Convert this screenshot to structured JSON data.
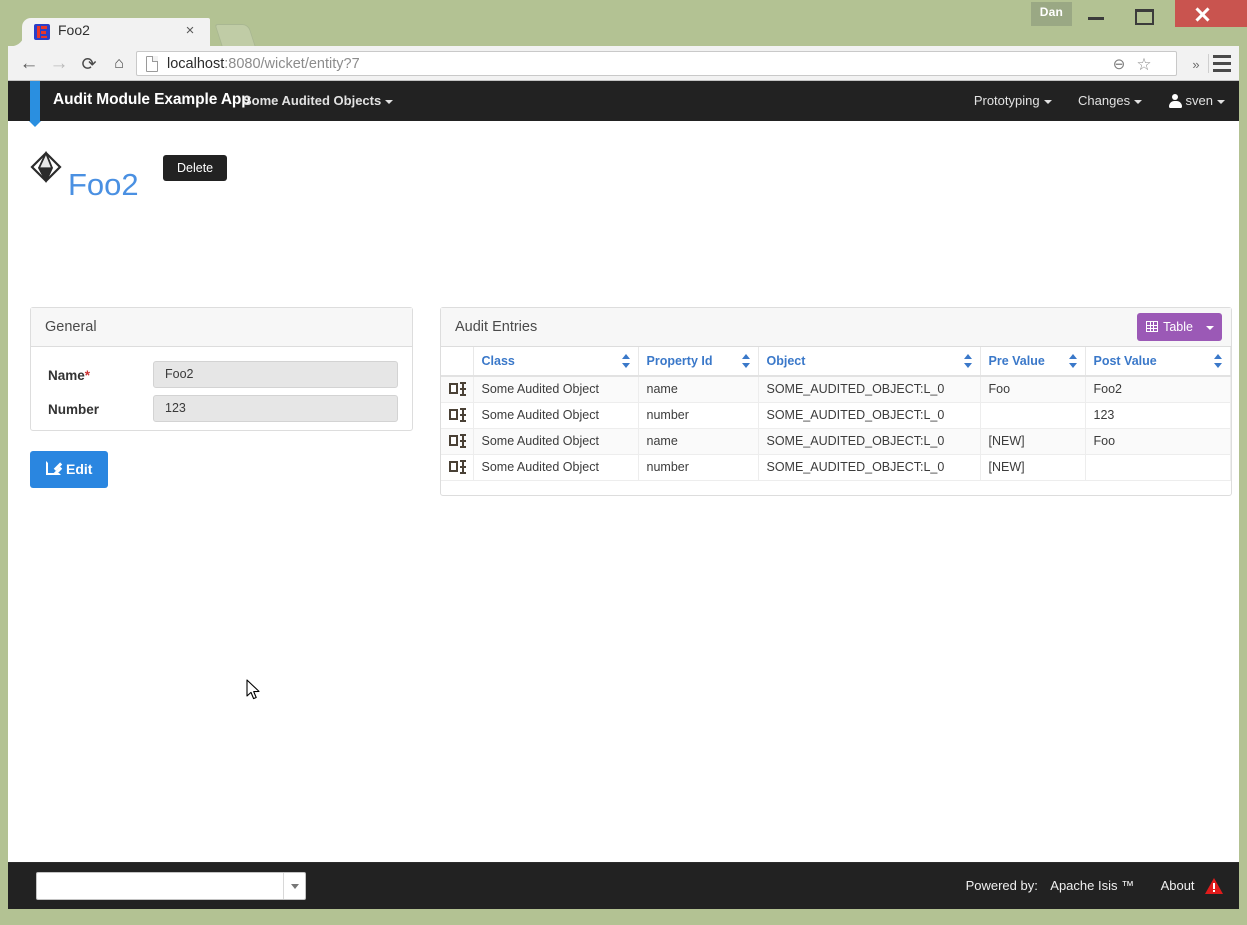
{
  "window": {
    "user_chip": "Dan",
    "minimize_label": "Minimize",
    "maximize_label": "Maximize",
    "close_label": "Close"
  },
  "browser": {
    "tab": {
      "title": "Foo2",
      "close_label": "×",
      "favicon_name": "apache-isis-favicon"
    },
    "new_tab_label": "",
    "omnibox": {
      "url_host": "localhost",
      "url_rest": ":8080/wicket/entity?7",
      "url_full": "localhost:8080/wicket/entity?7"
    },
    "toolbar": {
      "back": "←",
      "forward": "→",
      "reload": "⟳",
      "home": "⌂",
      "zoom": "⊖",
      "bookmark": "☆",
      "overflow": "»"
    }
  },
  "navbar": {
    "brand": "Audit Module Example App",
    "menu_some_audited_objects": "Some Audited Objects",
    "right_items": [
      {
        "label": "Prototyping",
        "has_caret": true
      },
      {
        "label": "Changes",
        "has_caret": true
      },
      {
        "label": "sven",
        "has_caret": true,
        "icon": "user-icon"
      }
    ]
  },
  "header": {
    "entity_icon": "octahedron-entity-icon",
    "title": "Foo2",
    "delete_label": "Delete"
  },
  "general_panel": {
    "heading": "General",
    "properties": [
      {
        "label": "Name",
        "required": true,
        "value": "Foo2"
      },
      {
        "label": "Number",
        "required": false,
        "value": "123"
      }
    ],
    "edit_label": "Edit"
  },
  "audit_panel": {
    "heading": "Audit Entries",
    "view_dropdown": {
      "label": "Table",
      "icon": "table-grid-icon",
      "color": "#9b59b6"
    },
    "columns": [
      "",
      "Class",
      "Property Id",
      "Object",
      "Pre Value",
      "Post Value"
    ],
    "rows": [
      {
        "icon": "entity-link-icon",
        "class": "Some Audited Object",
        "property_id": "name",
        "object": "SOME_AUDITED_OBJECT:L_0",
        "pre_value": "Foo",
        "post_value": "Foo2"
      },
      {
        "icon": "entity-link-icon",
        "class": "Some Audited Object",
        "property_id": "number",
        "object": "SOME_AUDITED_OBJECT:L_0",
        "pre_value": "",
        "post_value": "123"
      },
      {
        "icon": "entity-link-icon",
        "class": "Some Audited Object",
        "property_id": "name",
        "object": "SOME_AUDITED_OBJECT:L_0",
        "pre_value": "[NEW]",
        "post_value": "Foo"
      },
      {
        "icon": "entity-link-icon",
        "class": "Some Audited Object",
        "property_id": "number",
        "object": "SOME_AUDITED_OBJECT:L_0",
        "pre_value": "[NEW]",
        "post_value": ""
      }
    ]
  },
  "footer": {
    "select_value": "",
    "powered_by_label": "Powered by:",
    "framework": "Apache Isis ™",
    "about_label": "About"
  },
  "colors": {
    "accent_blue": "#2a8fe0",
    "title_blue": "#4a90e2",
    "dark": "#222222",
    "purple": "#9b59b6",
    "link_blue": "#3a78c9",
    "required_red": "#cc3333",
    "warn_red": "#e01b1b",
    "chrome_bg": "#b3c293"
  }
}
